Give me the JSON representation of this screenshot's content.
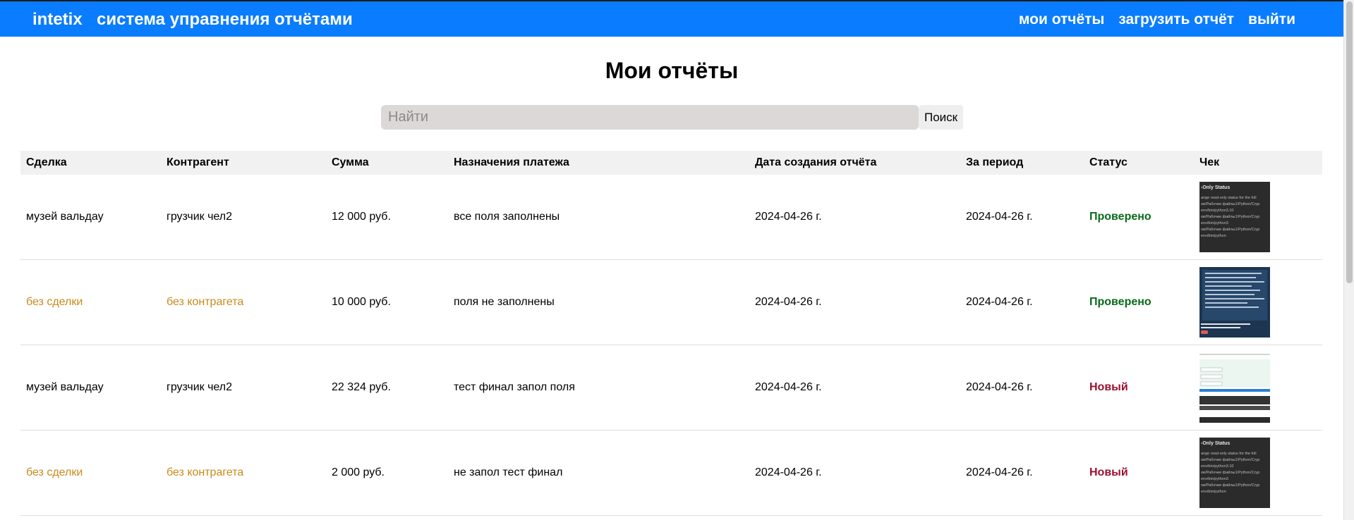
{
  "header": {
    "brand": "intetix",
    "title": "система управнения отчётами",
    "nav": [
      "мои отчёты",
      "загрузить отчёт",
      "выйти"
    ]
  },
  "page": {
    "title": "Мои отчёты",
    "search_placeholder": "Найти",
    "search_button": "Поиск"
  },
  "table": {
    "columns": [
      "Сделка",
      "Контрагент",
      "Сумма",
      "Назначения платежа",
      "Дата создания отчёта",
      "За период",
      "Статус",
      "Чек"
    ],
    "rows": [
      {
        "deal": "музей вальдау",
        "counterparty": "грузчик чел2",
        "amount": "12 000 руб.",
        "purpose": "все поля заполнены",
        "created": "2024-04-26 г.",
        "period": "2024-04-26 г.",
        "status": "Проверено",
        "status_type": "ok",
        "deal_muted": false,
        "receipt": "terminal"
      },
      {
        "deal": "без сделки",
        "counterparty": "без контрагета",
        "amount": "10 000 руб.",
        "purpose": "поля не заполнены",
        "created": "2024-04-26 г.",
        "period": "2024-04-26 г.",
        "status": "Проверено",
        "status_type": "ok",
        "deal_muted": true,
        "receipt": "dialog"
      },
      {
        "deal": "музей вальдау",
        "counterparty": "грузчик чел2",
        "amount": "22 324 руб.",
        "purpose": "тест финал запол поля",
        "created": "2024-04-26 г.",
        "period": "2024-04-26 г.",
        "status": "Новый",
        "status_type": "new",
        "deal_muted": false,
        "receipt": "form"
      },
      {
        "deal": "без сделки",
        "counterparty": "без контрагета",
        "amount": "2 000 руб.",
        "purpose": "не запол тест финал",
        "created": "2024-04-26 г.",
        "period": "2024-04-26 г.",
        "status": "Новый",
        "status_type": "new",
        "deal_muted": true,
        "receipt": "terminal"
      }
    ],
    "receipt_text": {
      "terminal_title": "-Only Status",
      "terminal_lines": [
        "ange read-only status for the foll",
        "ов/Рабочие файлы1/Python/Cryp",
        "env/bin/python3.10",
        "ов/Рабочие файлы1/Python/Cryp",
        "env/bin/python3",
        "ов/Рабочие файлы1/Python/Cryp",
        "env/bin/python"
      ]
    }
  },
  "colors": {
    "header_bg": "#0a7cff",
    "muted_text": "#c98a1a",
    "status_ok": "#0a6a1a",
    "status_new": "#9a1030"
  }
}
